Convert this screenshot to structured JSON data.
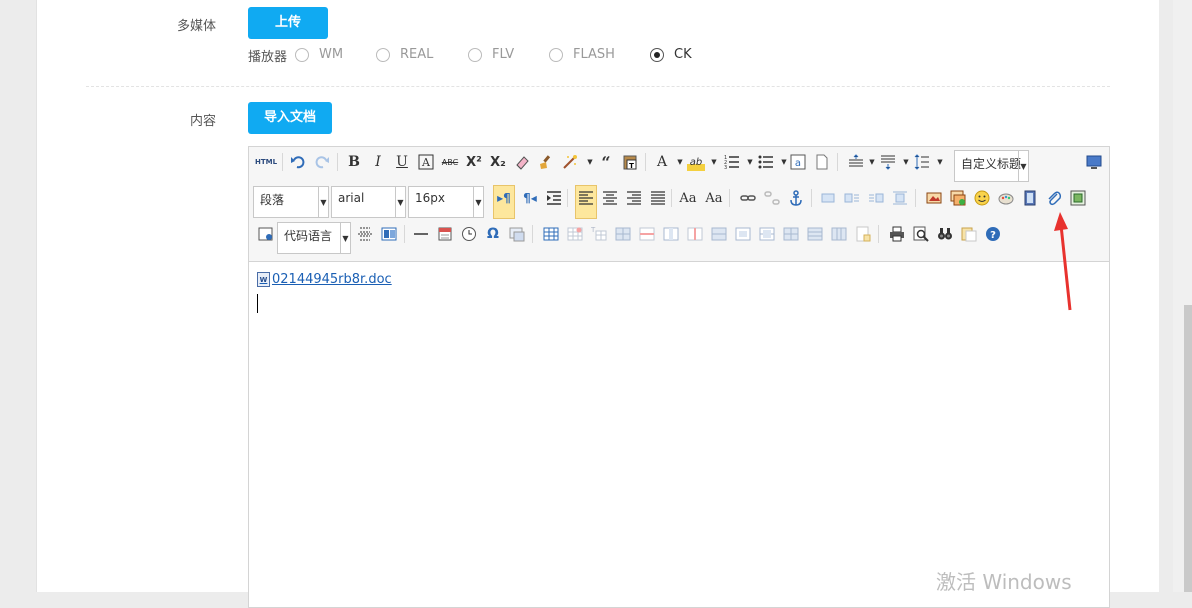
{
  "form": {
    "multimedia_label": "多媒体",
    "upload_button": "上传",
    "player_label": "播放器",
    "players": [
      {
        "label": "WM",
        "checked": false
      },
      {
        "label": "REAL",
        "checked": false
      },
      {
        "label": "FLV",
        "checked": false
      },
      {
        "label": "FLASH",
        "checked": false
      },
      {
        "label": "CK",
        "checked": true
      }
    ],
    "content_label": "内容",
    "import_button": "导入文档"
  },
  "editor": {
    "paragraph_select": "段落",
    "font_select": "arial",
    "size_select": "16px",
    "custom_title_select": "自定义标题",
    "code_lang_select": "代码语言",
    "html_button": "HTML",
    "attachment_link": "02144945rb8r.doc",
    "doc_icon_text": "W"
  },
  "system": {
    "watermark": "激活 Windows"
  },
  "colors": {
    "primary_button": "#10aaf2",
    "highlight": "#fde79d",
    "annotation_arrow": "#e8322e"
  }
}
